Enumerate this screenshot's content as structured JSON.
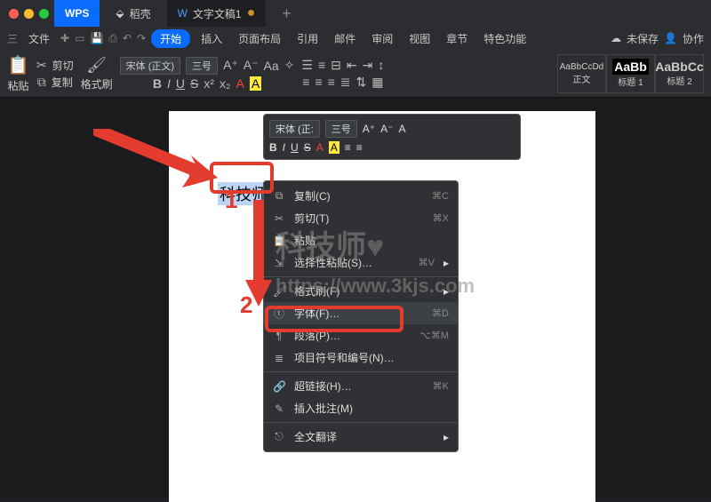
{
  "titlebar": {
    "wps": "WPS",
    "tab1": "稻壳",
    "tab2": "文字文稿1",
    "add": "+"
  },
  "menubar": {
    "san": "三",
    "file": "文件",
    "undo": "↶",
    "redo": "↷",
    "start": "开始",
    "items": [
      "插入",
      "页面布局",
      "引用",
      "邮件",
      "审阅",
      "视图",
      "章节",
      "特色功能"
    ],
    "unsaved": "未保存",
    "coop": "协作"
  },
  "ribbon": {
    "paste": "粘贴",
    "cut": "剪切",
    "copy": "复制",
    "brush": "格式刷",
    "font": "宋体 (正文)",
    "size": "三号",
    "bold": "B",
    "italic": "I",
    "underline": "U",
    "strike": "S",
    "sup": "x²",
    "sub": "x₂",
    "styles": [
      {
        "prev": "AaBbCcDd",
        "name": "正文"
      },
      {
        "prev": "AaBb",
        "name": "标题 1"
      },
      {
        "prev": "AaBbCc",
        "name": "标题 2"
      }
    ]
  },
  "typed_text": "科技师",
  "mini": {
    "font": "宋体 (正:",
    "size": "三号",
    "Aplus": "A⁺",
    "Aminus": "A⁻",
    "Acase": "A",
    "row2": [
      "B",
      "I",
      "U",
      "S",
      "A",
      "A",
      "≡",
      "≡"
    ]
  },
  "ctx": [
    {
      "icon": "⧉",
      "label": "复制(C)",
      "sc": "⌘C"
    },
    {
      "icon": "✂",
      "label": "剪切(T)",
      "sc": "⌘X"
    },
    {
      "icon": "📋",
      "label": "粘贴",
      "sc": ""
    },
    {
      "icon": "⇲",
      "label": "选择性粘贴(S)…",
      "sc": "⌘V",
      "sub": "▸"
    },
    {
      "sep": true
    },
    {
      "icon": "🖌",
      "label": "格式刷(F)",
      "sc": "",
      "sub": "▸"
    },
    {
      "icon": "ⓣ",
      "label": "字体(F)…",
      "sc": "⌘D",
      "hl": true
    },
    {
      "icon": "¶",
      "label": "段落(P)…",
      "sc": "⌥⌘M"
    },
    {
      "icon": "≣",
      "label": "项目符号和编号(N)…",
      "sc": ""
    },
    {
      "sep": true
    },
    {
      "icon": "🔗",
      "label": "超链接(H)…",
      "sc": "⌘K"
    },
    {
      "icon": "✎",
      "label": "插入批注(M)",
      "sc": ""
    },
    {
      "sep": true
    },
    {
      "icon": "⎋",
      "label": "全文翻译",
      "sc": "",
      "sub": "▸"
    }
  ],
  "annot": {
    "n1": "1",
    "n2": "2"
  },
  "watermark": {
    "line1": "科技师",
    "line2": "https://www.3kjs.com"
  }
}
